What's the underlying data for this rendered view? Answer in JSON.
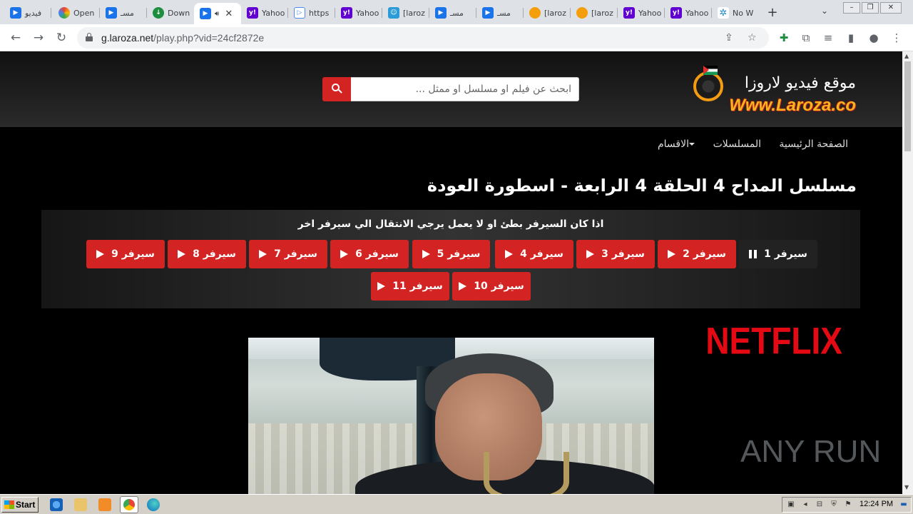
{
  "browser": {
    "tabs": [
      {
        "label": "فيديو",
        "icon": "play-blue"
      },
      {
        "label": "Open",
        "icon": "rainbow"
      },
      {
        "label": "مسـ",
        "icon": "play-blue"
      },
      {
        "label": "Down",
        "icon": "download-green"
      },
      {
        "label": "",
        "icon": "play-blue",
        "active": true,
        "audio": true
      },
      {
        "label": "Yahoo",
        "icon": "yahoo"
      },
      {
        "label": "https",
        "icon": "play-outline"
      },
      {
        "label": "Yahoo",
        "icon": "yahoo"
      },
      {
        "label": "[laroz",
        "icon": "smile-blue"
      },
      {
        "label": "مسـ",
        "icon": "play-blue"
      },
      {
        "label": "مسـ",
        "icon": "play-blue"
      },
      {
        "label": "[laroz",
        "icon": "orange"
      },
      {
        "label": "[laroz",
        "icon": "orange"
      },
      {
        "label": "Yahoo",
        "icon": "yahoo"
      },
      {
        "label": "Yahoo",
        "icon": "yahoo"
      },
      {
        "label": "No W",
        "icon": "anyrun"
      }
    ],
    "new_tab": "+",
    "url_host": "g.laroza.net",
    "url_path": "/play.php?vid=24cf2872e"
  },
  "site": {
    "logo_title": "موقع فيديو لاروزا",
    "logo_domain": "Www.Laroza.co",
    "search_placeholder": "ابحث عن فيلم او مسلسل او ممثل ...",
    "nav": {
      "home": "الصفحة الرئيسية",
      "series": "المسلسلات",
      "sections": "الاقسام"
    },
    "page_title": "مسلسل المداح 4 الحلقة 4 الرابعة - اسطورة العودة",
    "server_note": "اذا كان السيرفر بطئ او لا يعمل يرجي الانتقال الي سيرفر اخر",
    "servers": [
      "سيرفر 1",
      "سيرفر 2",
      "سيرفر 3",
      "سيرفر 4",
      "سيرفر 5",
      "سيرفر 6",
      "سيرفر 7",
      "سيرفر 8",
      "سيرفر 9",
      "سيرفر 10",
      "سيرفر 11"
    ],
    "player_brand": "NETFLIX"
  },
  "watermark": "ANY RUN",
  "taskbar": {
    "start_label": "Start",
    "clock": "12:24 PM"
  },
  "colors": {
    "accent_red": "#d32323",
    "netflix_red": "#e50914",
    "logo_gold": "#f7b51d"
  }
}
